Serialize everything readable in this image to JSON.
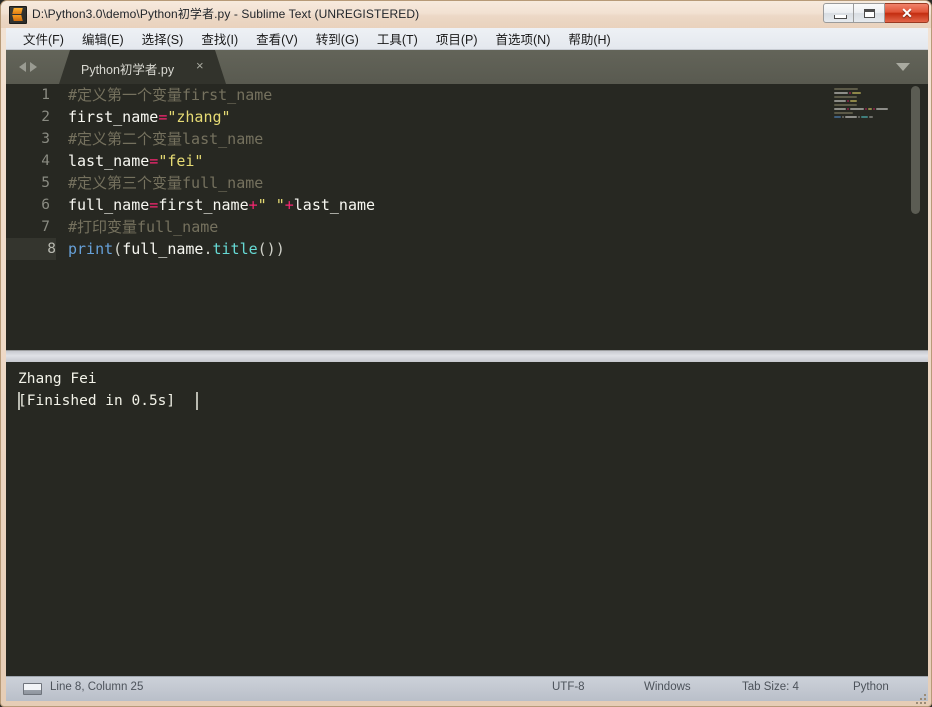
{
  "window": {
    "title": "D:\\Python3.0\\demo\\Python初学者.py - Sublime Text (UNREGISTERED)",
    "app_icon": "sublime-text-icon",
    "controls": {
      "minimize": "minimize-icon",
      "maximize": "maximize-icon",
      "close": "✕"
    }
  },
  "menubar": {
    "items": [
      {
        "label": "文件(F)"
      },
      {
        "label": "编辑(E)"
      },
      {
        "label": "选择(S)"
      },
      {
        "label": "查找(I)"
      },
      {
        "label": "查看(V)"
      },
      {
        "label": "转到(G)"
      },
      {
        "label": "工具(T)"
      },
      {
        "label": "项目(P)"
      },
      {
        "label": "首选项(N)"
      },
      {
        "label": "帮助(H)"
      }
    ]
  },
  "tabbar": {
    "prev_icon": "triangle-left-icon",
    "next_icon": "triangle-right-icon",
    "active_tab": "Python初学者.py",
    "close_glyph": "×",
    "menu_icon": "chevron-down-icon"
  },
  "editor": {
    "line_numbers": [
      "1",
      "2",
      "3",
      "4",
      "5",
      "6",
      "7",
      "8"
    ],
    "active_line": 8,
    "lines": [
      {
        "n": "1",
        "tokens": [
          {
            "t": "#定义第一个变量first_name",
            "c": "comment"
          }
        ]
      },
      {
        "n": "2",
        "tokens": [
          {
            "t": "first_name",
            "c": "plain"
          },
          {
            "t": "=",
            "c": "op"
          },
          {
            "t": "\"zhang\"",
            "c": "string"
          }
        ]
      },
      {
        "n": "3",
        "tokens": [
          {
            "t": "#定义第二个变量last_name",
            "c": "comment"
          }
        ]
      },
      {
        "n": "4",
        "tokens": [
          {
            "t": "last_name",
            "c": "plain"
          },
          {
            "t": "=",
            "c": "op"
          },
          {
            "t": "\"fei\"",
            "c": "string"
          }
        ]
      },
      {
        "n": "5",
        "tokens": [
          {
            "t": "#定义第三个变量full_name",
            "c": "comment"
          }
        ]
      },
      {
        "n": "6",
        "tokens": [
          {
            "t": "full_name",
            "c": "plain"
          },
          {
            "t": "=",
            "c": "op"
          },
          {
            "t": "first_name",
            "c": "plain"
          },
          {
            "t": "+",
            "c": "op"
          },
          {
            "t": "\" \"",
            "c": "string"
          },
          {
            "t": "+",
            "c": "op"
          },
          {
            "t": "last_name",
            "c": "plain"
          }
        ]
      },
      {
        "n": "7",
        "tokens": [
          {
            "t": "#打印变量full_name",
            "c": "comment"
          }
        ]
      },
      {
        "n": "8",
        "tokens": [
          {
            "t": "print",
            "c": "fn"
          },
          {
            "t": "(",
            "c": "punc"
          },
          {
            "t": "full_name",
            "c": "plain"
          },
          {
            "t": ".",
            "c": "punc"
          },
          {
            "t": "title",
            "c": "method"
          },
          {
            "t": "())",
            "c": "punc"
          }
        ]
      }
    ],
    "colors": {
      "background": "#272822",
      "comment": "#75715e",
      "string": "#e6db74",
      "operator": "#f92672",
      "function": "#66a0d8",
      "method": "#66d9d4",
      "plain": "#f8f8f2",
      "gutter_text": "#8a8b82",
      "active_line_gutter_bg": "#34352e"
    }
  },
  "console": {
    "lines": [
      {
        "text": "Zhang Fei",
        "selected": false
      },
      {
        "text": "[Finished in 0.5s]",
        "selected": true
      }
    ]
  },
  "statusbar": {
    "panel_icon": "console-panel-icon",
    "cursor_position": "Line 8, Column 25",
    "encoding": "UTF-8",
    "line_endings": "Windows",
    "tab_size": "Tab Size: 4",
    "syntax": "Python"
  }
}
